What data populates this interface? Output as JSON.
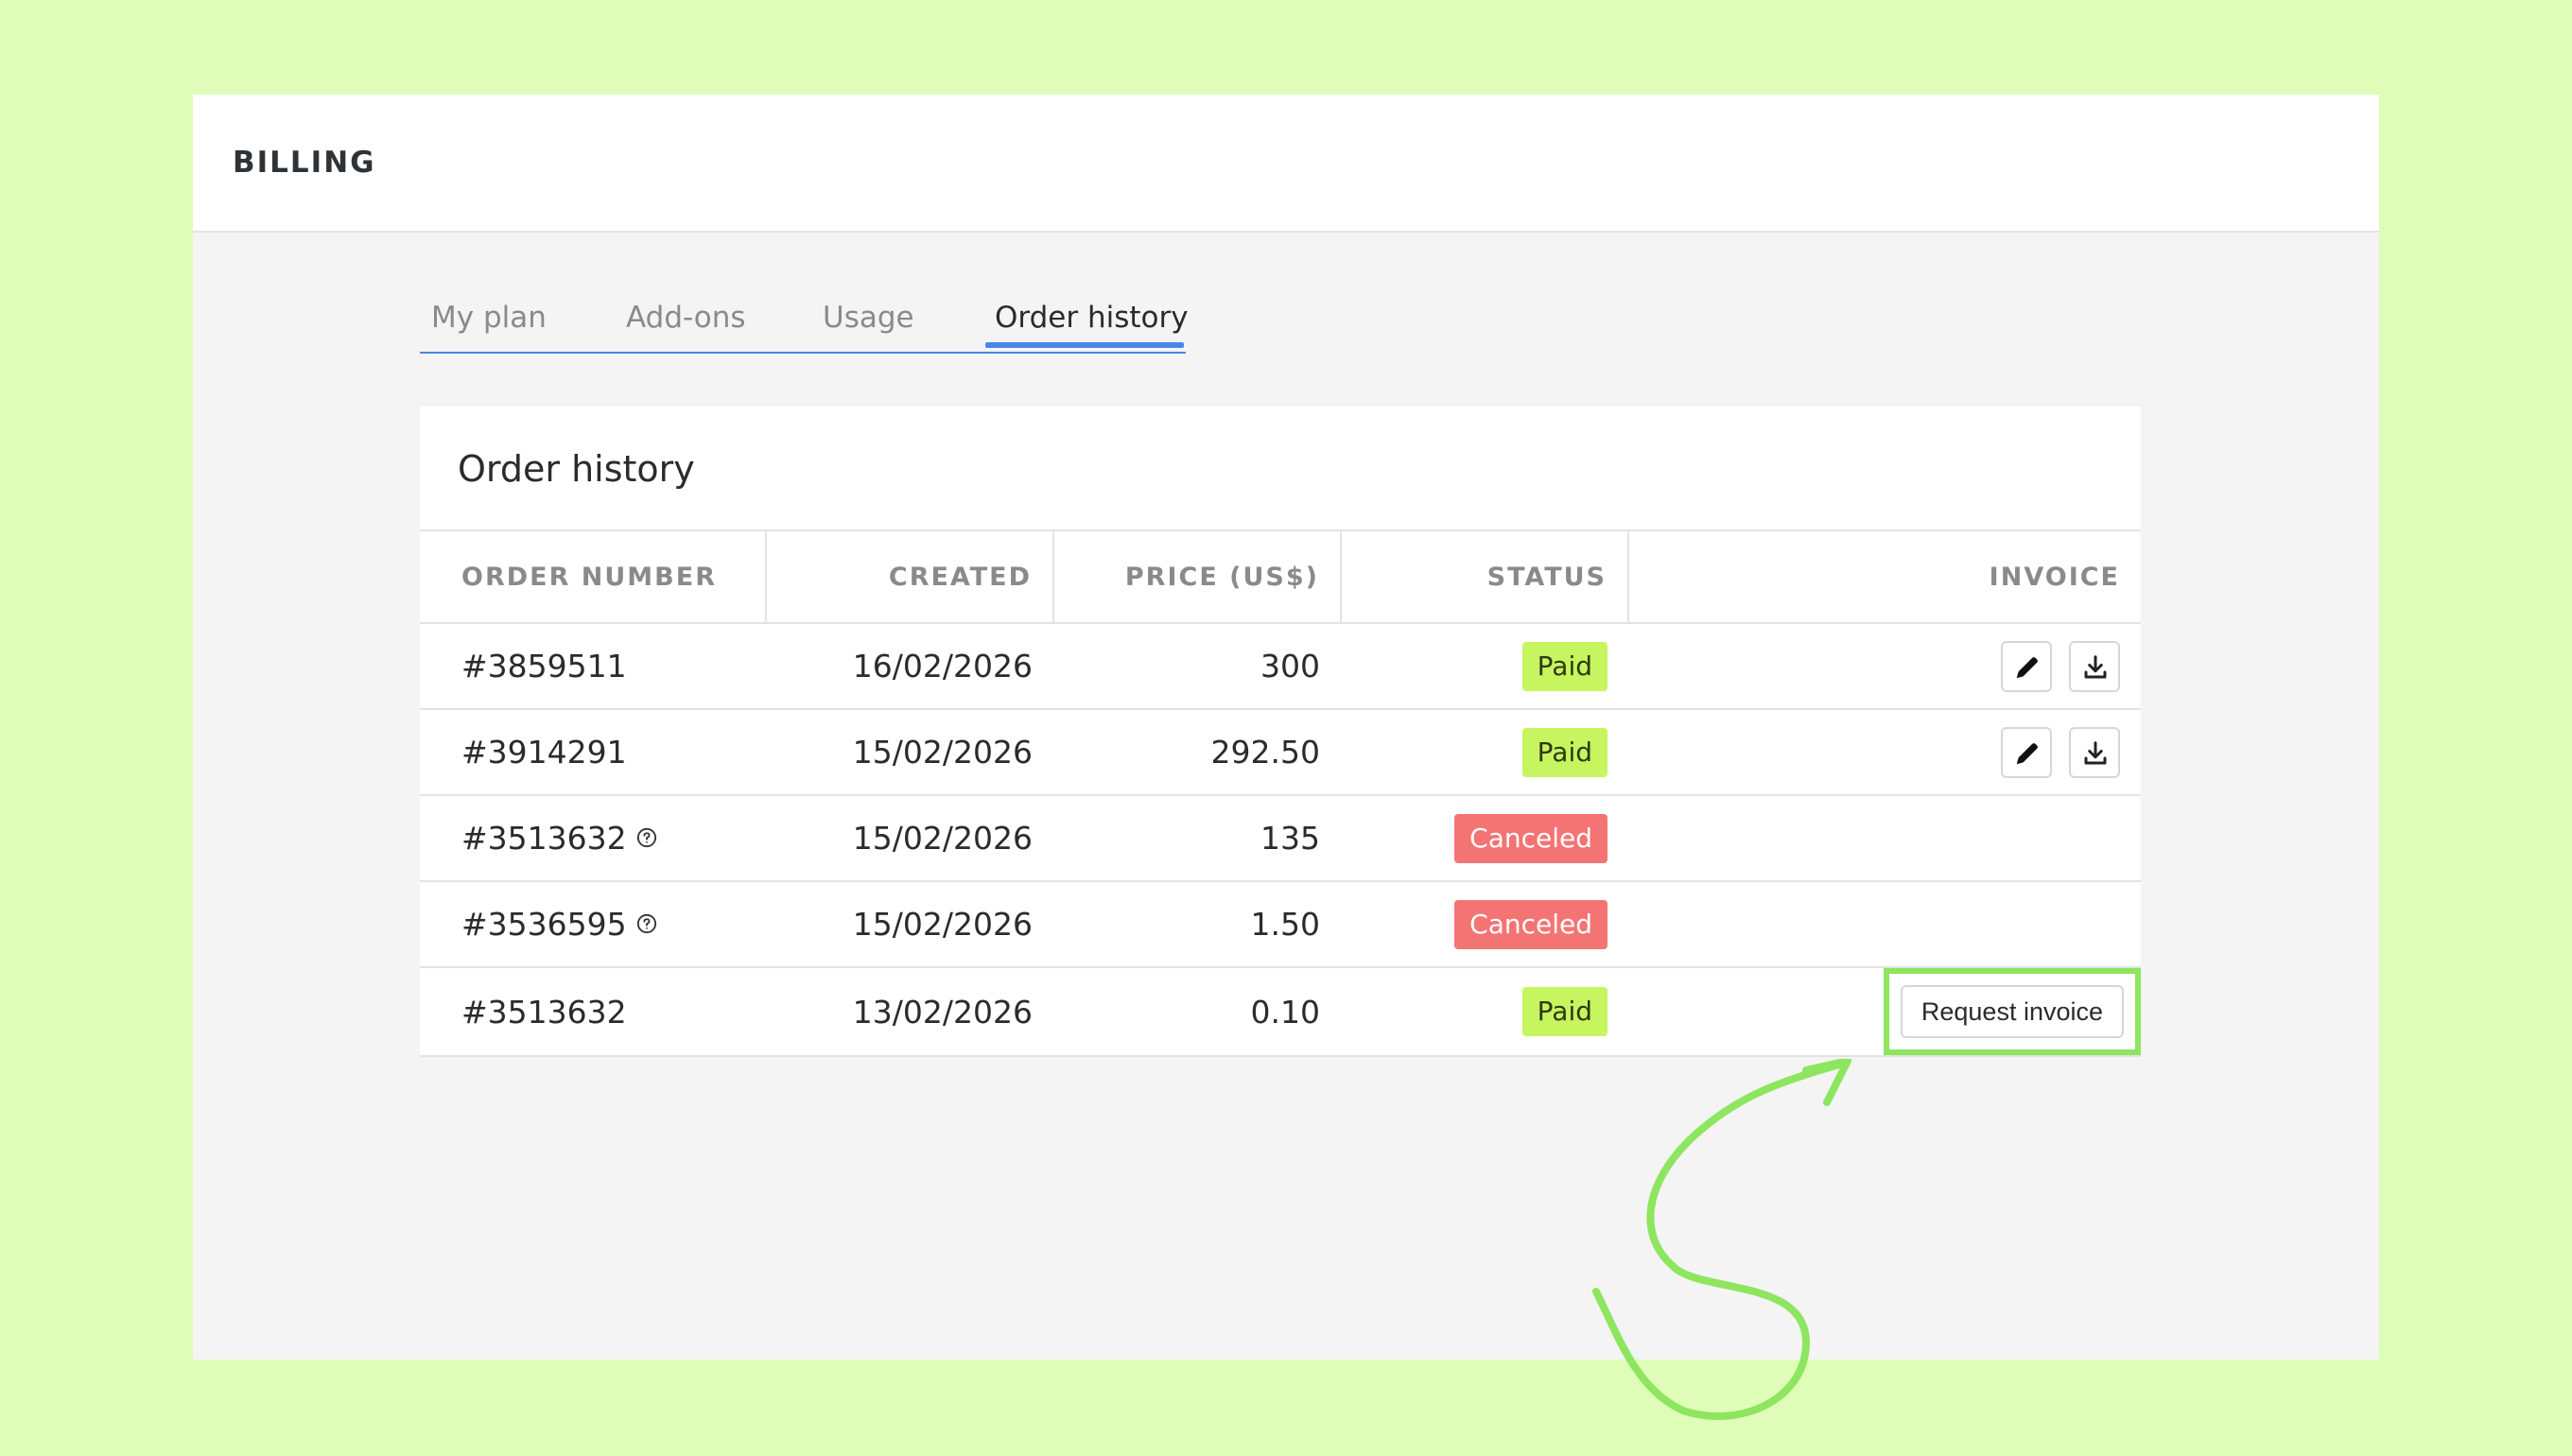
{
  "header": {
    "title": "BILLING"
  },
  "tabs": [
    {
      "label": "My plan"
    },
    {
      "label": "Add-ons"
    },
    {
      "label": "Usage"
    },
    {
      "label": "Order history",
      "active": true
    }
  ],
  "card": {
    "title": "Order history"
  },
  "table": {
    "columns": [
      "ORDER NUMBER",
      "CREATED",
      "PRICE (US$)",
      "STATUS",
      "INVOICE"
    ],
    "rows": [
      {
        "order": "#3859511",
        "help": false,
        "created": "16/02/2026",
        "price": "300",
        "status": "Paid",
        "invoice": "icons"
      },
      {
        "order": "#3914291",
        "help": false,
        "created": "15/02/2026",
        "price": "292.50",
        "status": "Paid",
        "invoice": "icons"
      },
      {
        "order": "#3513632",
        "help": true,
        "created": "15/02/2026",
        "price": "135",
        "status": "Canceled",
        "invoice": "none"
      },
      {
        "order": "#3536595",
        "help": true,
        "created": "15/02/2026",
        "price": "1.50",
        "status": "Canceled",
        "invoice": "none"
      },
      {
        "order": "#3513632",
        "help": false,
        "created": "13/02/2026",
        "price": "0.10",
        "status": "Paid",
        "invoice": "request"
      }
    ],
    "request_invoice_label": "Request invoice"
  },
  "icons": {
    "edit": "pencil-icon",
    "download": "download-icon",
    "help": "question-circle-icon"
  },
  "colors": {
    "background": "#dffcb8",
    "tab_accent": "#4a86e8",
    "paid": "#c6f55f",
    "canceled": "#f47474",
    "highlight": "#8ee55f"
  }
}
